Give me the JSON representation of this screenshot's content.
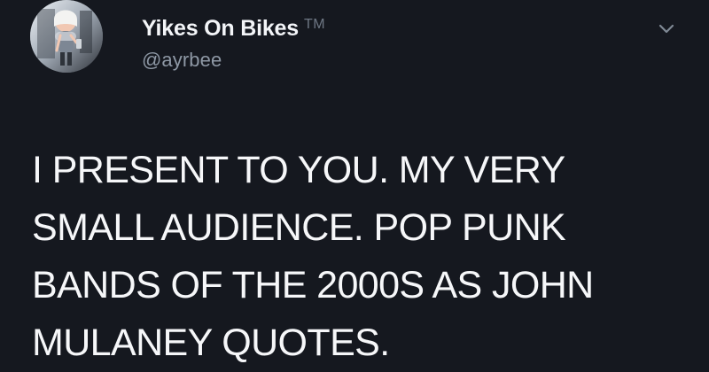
{
  "user": {
    "display_name": "Yikes On Bikes",
    "tm_label": "TM",
    "handle": "@ayrbee"
  },
  "icons": {
    "avatar": "avatar-image",
    "chevron": "chevron-down-icon"
  },
  "tweet": {
    "text": "I PRESENT TO YOU. MY VERY SMALL AUDIENCE. POP PUNK BANDS OF THE 2000S AS JOHN MULANEY QUOTES."
  },
  "colors": {
    "background": "#15181f",
    "text": "#f6f7f9",
    "secondary_text": "#8e98a5",
    "tm": "#6e7784"
  }
}
